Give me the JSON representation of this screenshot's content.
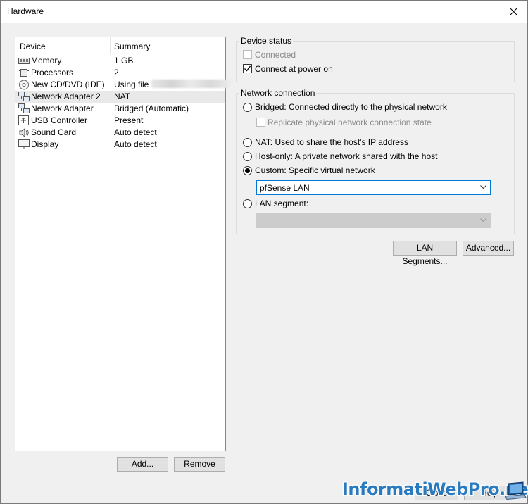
{
  "window": {
    "title": "Hardware"
  },
  "device_list": {
    "columns": {
      "device": "Device",
      "summary": "Summary"
    },
    "rows": [
      {
        "device": "Memory",
        "summary": "1 GB",
        "icon": "memory-icon"
      },
      {
        "device": "Processors",
        "summary": "2",
        "icon": "processor-icon"
      },
      {
        "device": "New CD/DVD (IDE)",
        "summary": "Using file",
        "icon": "cd-dvd-icon"
      },
      {
        "device": "Network Adapter 2",
        "summary": "NAT",
        "icon": "network-adapter-icon",
        "selected": true
      },
      {
        "device": "Network Adapter",
        "summary": "Bridged (Automatic)",
        "icon": "network-adapter-icon"
      },
      {
        "device": "USB Controller",
        "summary": "Present",
        "icon": "usb-icon"
      },
      {
        "device": "Sound Card",
        "summary": "Auto detect",
        "icon": "speaker-icon"
      },
      {
        "device": "Display",
        "summary": "Auto detect",
        "icon": "monitor-icon"
      }
    ],
    "add_label": "Add...",
    "remove_label": "Remove"
  },
  "device_status": {
    "title": "Device status",
    "connected": {
      "label": "Connected",
      "checked": false,
      "disabled": true
    },
    "connect_at_power_on": {
      "label": "Connect at power on",
      "checked": true
    }
  },
  "network_connection": {
    "title": "Network connection",
    "bridged": {
      "label": "Bridged: Connected directly to the physical network",
      "selected": false
    },
    "replicate": {
      "label": "Replicate physical network connection state",
      "checked": false,
      "disabled": true
    },
    "nat": {
      "label": "NAT: Used to share the host's IP address",
      "selected": false
    },
    "host_only": {
      "label": "Host-only: A private network shared with the host",
      "selected": false
    },
    "custom": {
      "label": "Custom: Specific virtual network",
      "selected": true
    },
    "custom_select_value": "pfSense LAN",
    "lan_segment": {
      "label": "LAN segment:",
      "selected": false
    },
    "lan_segment_value": ""
  },
  "buttons": {
    "lan_segments": "LAN Segments...",
    "advanced": "Advanced...",
    "close": "Close",
    "help": "Help"
  },
  "watermark": "InformatiWebPro.net",
  "colors": {
    "accent": "#0078d7",
    "watermark": "#2a7abf"
  }
}
